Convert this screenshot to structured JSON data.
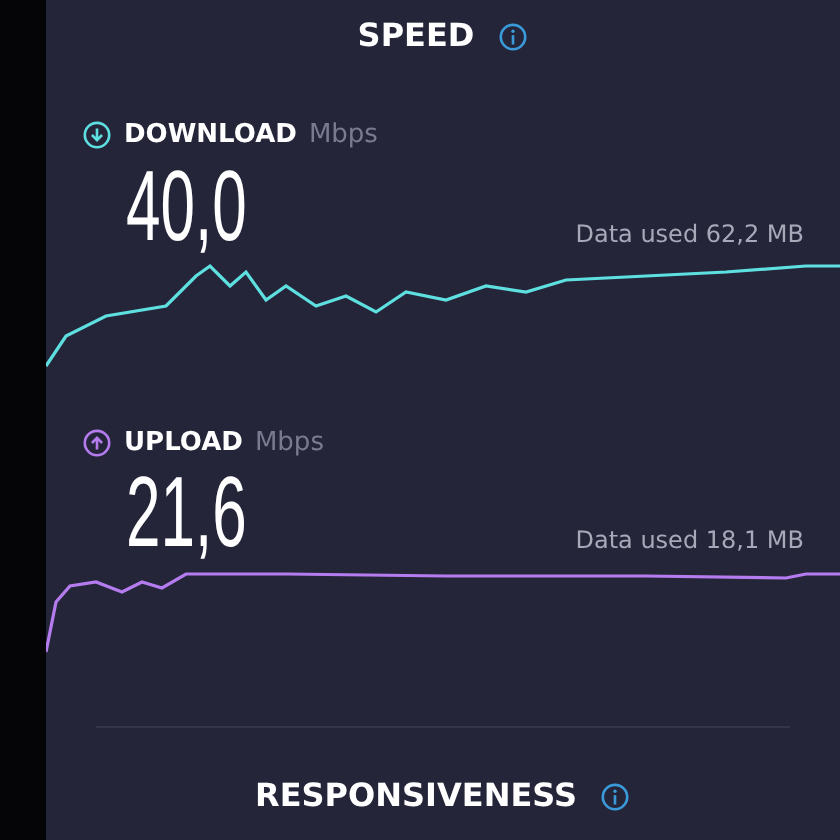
{
  "title": "SPEED",
  "metrics": [
    {
      "kind": "download",
      "label": "DOWNLOAD",
      "unit": "Mbps",
      "value": "40,0",
      "data_used": "Data used 62,2 MB",
      "color": "#5ee0e0"
    },
    {
      "kind": "upload",
      "label": "UPLOAD",
      "unit": "Mbps",
      "value": "21,6",
      "data_used": "Data used 18,1 MB",
      "color": "#b57cf0"
    }
  ],
  "next_section": "RESPONSIVENESS"
}
